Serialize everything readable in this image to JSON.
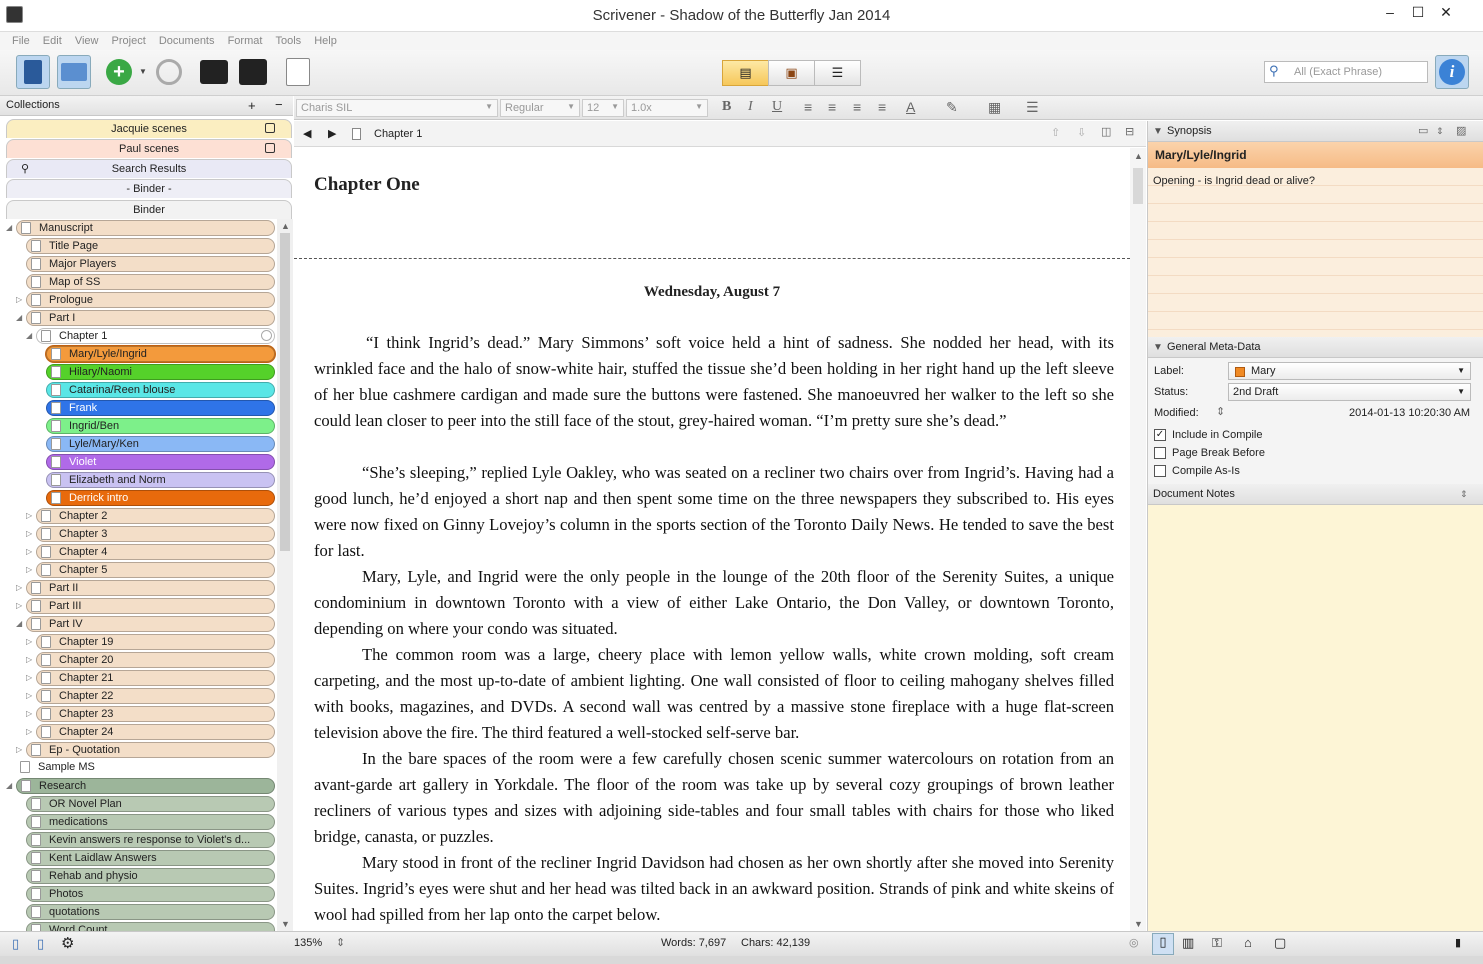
{
  "window": {
    "title": "Scrivener - Shadow of the Butterfly Jan 2014"
  },
  "menu": [
    "File",
    "Edit",
    "View",
    "Project",
    "Documents",
    "Format",
    "Tools",
    "Help"
  ],
  "toolbar": {
    "search_placeholder": "All (Exact Phrase)"
  },
  "collections": {
    "header": "Collections",
    "add": "+",
    "remove": "−",
    "tabs": [
      {
        "label": "Jacquie scenes",
        "color": "#fbeec1"
      },
      {
        "label": "Paul scenes",
        "color": "#fde0d4"
      },
      {
        "label": "Search Results",
        "color": "#e9e9f5"
      },
      {
        "label": "- Binder -",
        "color": "#eeeef6"
      },
      {
        "label": "Binder",
        "color": "#f2f2f2"
      }
    ]
  },
  "binder": [
    {
      "label": "Manuscript",
      "level": 0,
      "color": "#f3dec8",
      "tri": "open"
    },
    {
      "label": "Title Page",
      "level": 1,
      "color": "#f3dec8"
    },
    {
      "label": "Major Players",
      "level": 1,
      "color": "#f3dec8"
    },
    {
      "label": "Map of SS",
      "level": 1,
      "color": "#f3dec8"
    },
    {
      "label": "Prologue",
      "level": 1,
      "color": "#f3dec8",
      "tri": "closed"
    },
    {
      "label": "Part I",
      "level": 1,
      "color": "#f3dec8",
      "tri": "open"
    },
    {
      "label": "Chapter 1",
      "level": 2,
      "color": "#ffffff",
      "tri": "open"
    },
    {
      "label": "Mary/Lyle/Ingrid",
      "level": 3,
      "color": "#f39a3c"
    },
    {
      "label": "Hilary/Naomi",
      "level": 3,
      "color": "#55d12a"
    },
    {
      "label": "Catarina/Reen blouse",
      "level": 3,
      "color": "#5ae6e6"
    },
    {
      "label": "Frank",
      "level": 3,
      "color": "#2f74e8",
      "fg": "#fff"
    },
    {
      "label": "Ingrid/Ben",
      "level": 3,
      "color": "#7df08a"
    },
    {
      "label": "Lyle/Mary/Ken",
      "level": 3,
      "color": "#8ab8f5"
    },
    {
      "label": "Violet",
      "level": 3,
      "color": "#b06ae8",
      "fg": "#fff"
    },
    {
      "label": "Elizabeth and Norm",
      "level": 3,
      "color": "#c9c2f2"
    },
    {
      "label": "Derrick intro",
      "level": 3,
      "color": "#e86a0c",
      "fg": "#fff"
    },
    {
      "label": "Chapter 2",
      "level": 2,
      "color": "#f3dec8",
      "tri": "closed"
    },
    {
      "label": "Chapter 3",
      "level": 2,
      "color": "#f3dec8",
      "tri": "closed"
    },
    {
      "label": "Chapter 4",
      "level": 2,
      "color": "#f3dec8",
      "tri": "closed"
    },
    {
      "label": "Chapter 5",
      "level": 2,
      "color": "#f3dec8",
      "tri": "closed"
    },
    {
      "label": "Part II",
      "level": 1,
      "color": "#f3dec8",
      "tri": "closed"
    },
    {
      "label": "Part III",
      "level": 1,
      "color": "#f3dec8",
      "tri": "closed"
    },
    {
      "label": "Part IV",
      "level": 1,
      "color": "#f3dec8",
      "tri": "open"
    },
    {
      "label": "Chapter 19",
      "level": 2,
      "color": "#f3dec8",
      "tri": "closed"
    },
    {
      "label": "Chapter 20",
      "level": 2,
      "color": "#f3dec8",
      "tri": "closed"
    },
    {
      "label": "Chapter 21",
      "level": 2,
      "color": "#f3dec8",
      "tri": "closed"
    },
    {
      "label": "Chapter 22",
      "level": 2,
      "color": "#f3dec8",
      "tri": "closed"
    },
    {
      "label": "Chapter 23",
      "level": 2,
      "color": "#f3dec8",
      "tri": "closed"
    },
    {
      "label": "Chapter 24",
      "level": 2,
      "color": "#f3dec8",
      "tri": "closed"
    },
    {
      "label": "Ep - Quotation",
      "level": 1,
      "color": "#f3dec8",
      "tri": "closed"
    },
    {
      "label": "Sample MS",
      "level": 0,
      "color": "#ffffff",
      "plain": true
    },
    {
      "label": "Research",
      "level": 0,
      "color": "#9cb59a",
      "tri": "open"
    },
    {
      "label": "OR Novel Plan",
      "level": 1,
      "color": "#b8c9b3"
    },
    {
      "label": "medications",
      "level": 1,
      "color": "#b8c9b3"
    },
    {
      "label": "Kevin answers re response to Violet's d...",
      "level": 1,
      "color": "#b8c9b3"
    },
    {
      "label": "Kent Laidlaw Answers",
      "level": 1,
      "color": "#b8c9b3"
    },
    {
      "label": "Rehab and physio",
      "level": 1,
      "color": "#b8c9b3"
    },
    {
      "label": "Photos",
      "level": 1,
      "color": "#b8c9b3"
    },
    {
      "label": "quotations",
      "level": 1,
      "color": "#b8c9b3"
    },
    {
      "label": "Word Count",
      "level": 1,
      "color": "#b8c9b3"
    }
  ],
  "format": {
    "font": "Charis SIL",
    "style": "Regular",
    "size": "12",
    "spacing": "1.0x"
  },
  "editor": {
    "doc_title": "Chapter 1",
    "chapter_heading": "Chapter One",
    "date_heading": "Wednesday, August 7",
    "paragraphs": [
      "“I think Ingrid’s dead.” Mary Simmons’ soft voice held a hint of sadness. She nodded her head, with its wrinkled face and the halo of snow-white hair, stuffed the tissue she’d been holding in her right hand up the left sleeve of her blue cashmere cardigan and made sure the buttons were fastened. She manoeuvred her walker to the left so she could lean closer to peer into the still face of the stout, grey-haired woman. “I’m pretty sure she’s dead.”",
      "“She’s sleeping,” replied Lyle Oakley, who was seated on a recliner two chairs over from Ingrid’s. Having had a good lunch, he’d enjoyed a short nap and then spent some time on the three newspapers they subscribed to. His eyes were now fixed on Ginny Lovejoy’s column in the sports section of the Toronto Daily News. He tended to save the best for last.",
      "Mary, Lyle, and Ingrid were the only people in the lounge of the 20th floor of the Serenity Suites, a unique condominium in downtown Toronto with a view of either Lake Ontario, the Don Valley, or downtown Toronto, depending on where your condo was situated.",
      "The common room was a large, cheery place with lemon yellow walls, white crown molding, soft cream carpeting, and the most up-to-date of ambient lighting. One wall consisted of floor to ceiling mahogany shelves filled with books, magazines, and DVDs. A second wall was centred by a massive stone fireplace with a huge flat-screen television above the fire. The third featured a well-stocked self-serve bar.",
      "In the bare spaces of the room were a few carefully chosen scenic summer watercolours on rotation from an avant-garde art gallery in Yorkdale. The floor of the room was take up by several cozy groupings of brown leather recliners of various types and sizes with adjoining side-tables and four small tables with chairs for those who liked bridge, canasta, or puzzles.",
      "Mary stood in front of the recliner Ingrid Davidson had chosen as her own shortly after she moved into Serenity Suites. Ingrid’s eyes were shut and her head was tilted back in an awkward position. Strands of pink and white skeins of wool had spilled from her lap onto the carpet below."
    ]
  },
  "inspector": {
    "synopsis_header": "Synopsis",
    "synopsis_title": "Mary/Lyle/Ingrid",
    "synopsis_text": "Opening - is Ingrid dead or alive?",
    "meta_header": "General Meta-Data",
    "label_caption": "Label:",
    "label_value": "Mary",
    "label_color": "#f08a24",
    "status_caption": "Status:",
    "status_value": "2nd Draft",
    "modified_caption": "Modified:",
    "modified_value": "2014-01-13 10:20:30 AM",
    "checks": [
      {
        "label": "Include in Compile",
        "checked": true
      },
      {
        "label": "Page Break Before",
        "checked": false
      },
      {
        "label": "Compile As-Is",
        "checked": false
      }
    ],
    "notes_header": "Document Notes"
  },
  "status": {
    "zoom": "135%",
    "words": "Words: 7,697",
    "chars": "Chars: 42,139"
  }
}
